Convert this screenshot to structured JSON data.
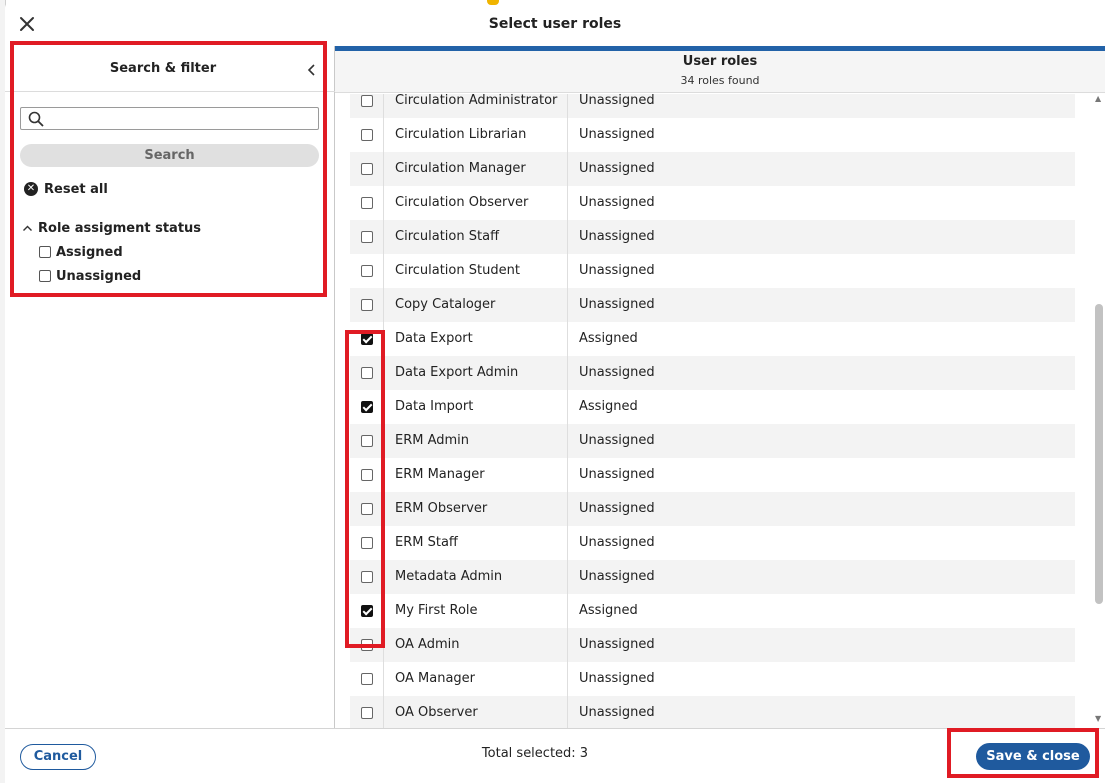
{
  "modal": {
    "title": "Select user roles"
  },
  "filter": {
    "title": "Search & filter",
    "search_placeholder": "",
    "search_value": "",
    "search_button": "Search",
    "reset_all": "Reset all",
    "section_title": "Role assigment status",
    "options": [
      {
        "label": "Assigned",
        "checked": false
      },
      {
        "label": "Unassigned",
        "checked": false
      }
    ]
  },
  "results": {
    "title": "User roles",
    "count_text": "34 roles found",
    "rows": [
      {
        "name": "Circulation Administrator",
        "status": "Unassigned",
        "checked": false
      },
      {
        "name": "Circulation Librarian",
        "status": "Unassigned",
        "checked": false
      },
      {
        "name": "Circulation Manager",
        "status": "Unassigned",
        "checked": false
      },
      {
        "name": "Circulation Observer",
        "status": "Unassigned",
        "checked": false
      },
      {
        "name": "Circulation Staff",
        "status": "Unassigned",
        "checked": false
      },
      {
        "name": "Circulation Student",
        "status": "Unassigned",
        "checked": false
      },
      {
        "name": "Copy Cataloger",
        "status": "Unassigned",
        "checked": false
      },
      {
        "name": "Data Export",
        "status": "Assigned",
        "checked": true
      },
      {
        "name": "Data Export Admin",
        "status": "Unassigned",
        "checked": false
      },
      {
        "name": "Data Import",
        "status": "Assigned",
        "checked": true
      },
      {
        "name": "ERM Admin",
        "status": "Unassigned",
        "checked": false
      },
      {
        "name": "ERM Manager",
        "status": "Unassigned",
        "checked": false
      },
      {
        "name": "ERM Observer",
        "status": "Unassigned",
        "checked": false
      },
      {
        "name": "ERM Staff",
        "status": "Unassigned",
        "checked": false
      },
      {
        "name": "Metadata Admin",
        "status": "Unassigned",
        "checked": false
      },
      {
        "name": "My First Role",
        "status": "Assigned",
        "checked": true
      },
      {
        "name": "OA Admin",
        "status": "Unassigned",
        "checked": false
      },
      {
        "name": "OA Manager",
        "status": "Unassigned",
        "checked": false
      },
      {
        "name": "OA Observer",
        "status": "Unassigned",
        "checked": false
      }
    ],
    "scroll_position": 0.33
  },
  "footer": {
    "cancel": "Cancel",
    "total_selected": "Total selected: 3",
    "save": "Save & close"
  },
  "colors": {
    "primary": "#1f5a9e",
    "header_accent": "#2262a8",
    "annotation": "#e01b24"
  },
  "icons": [
    "close-icon",
    "chevron-left-icon",
    "search-icon",
    "clear-circle-icon",
    "chevron-up-icon"
  ]
}
